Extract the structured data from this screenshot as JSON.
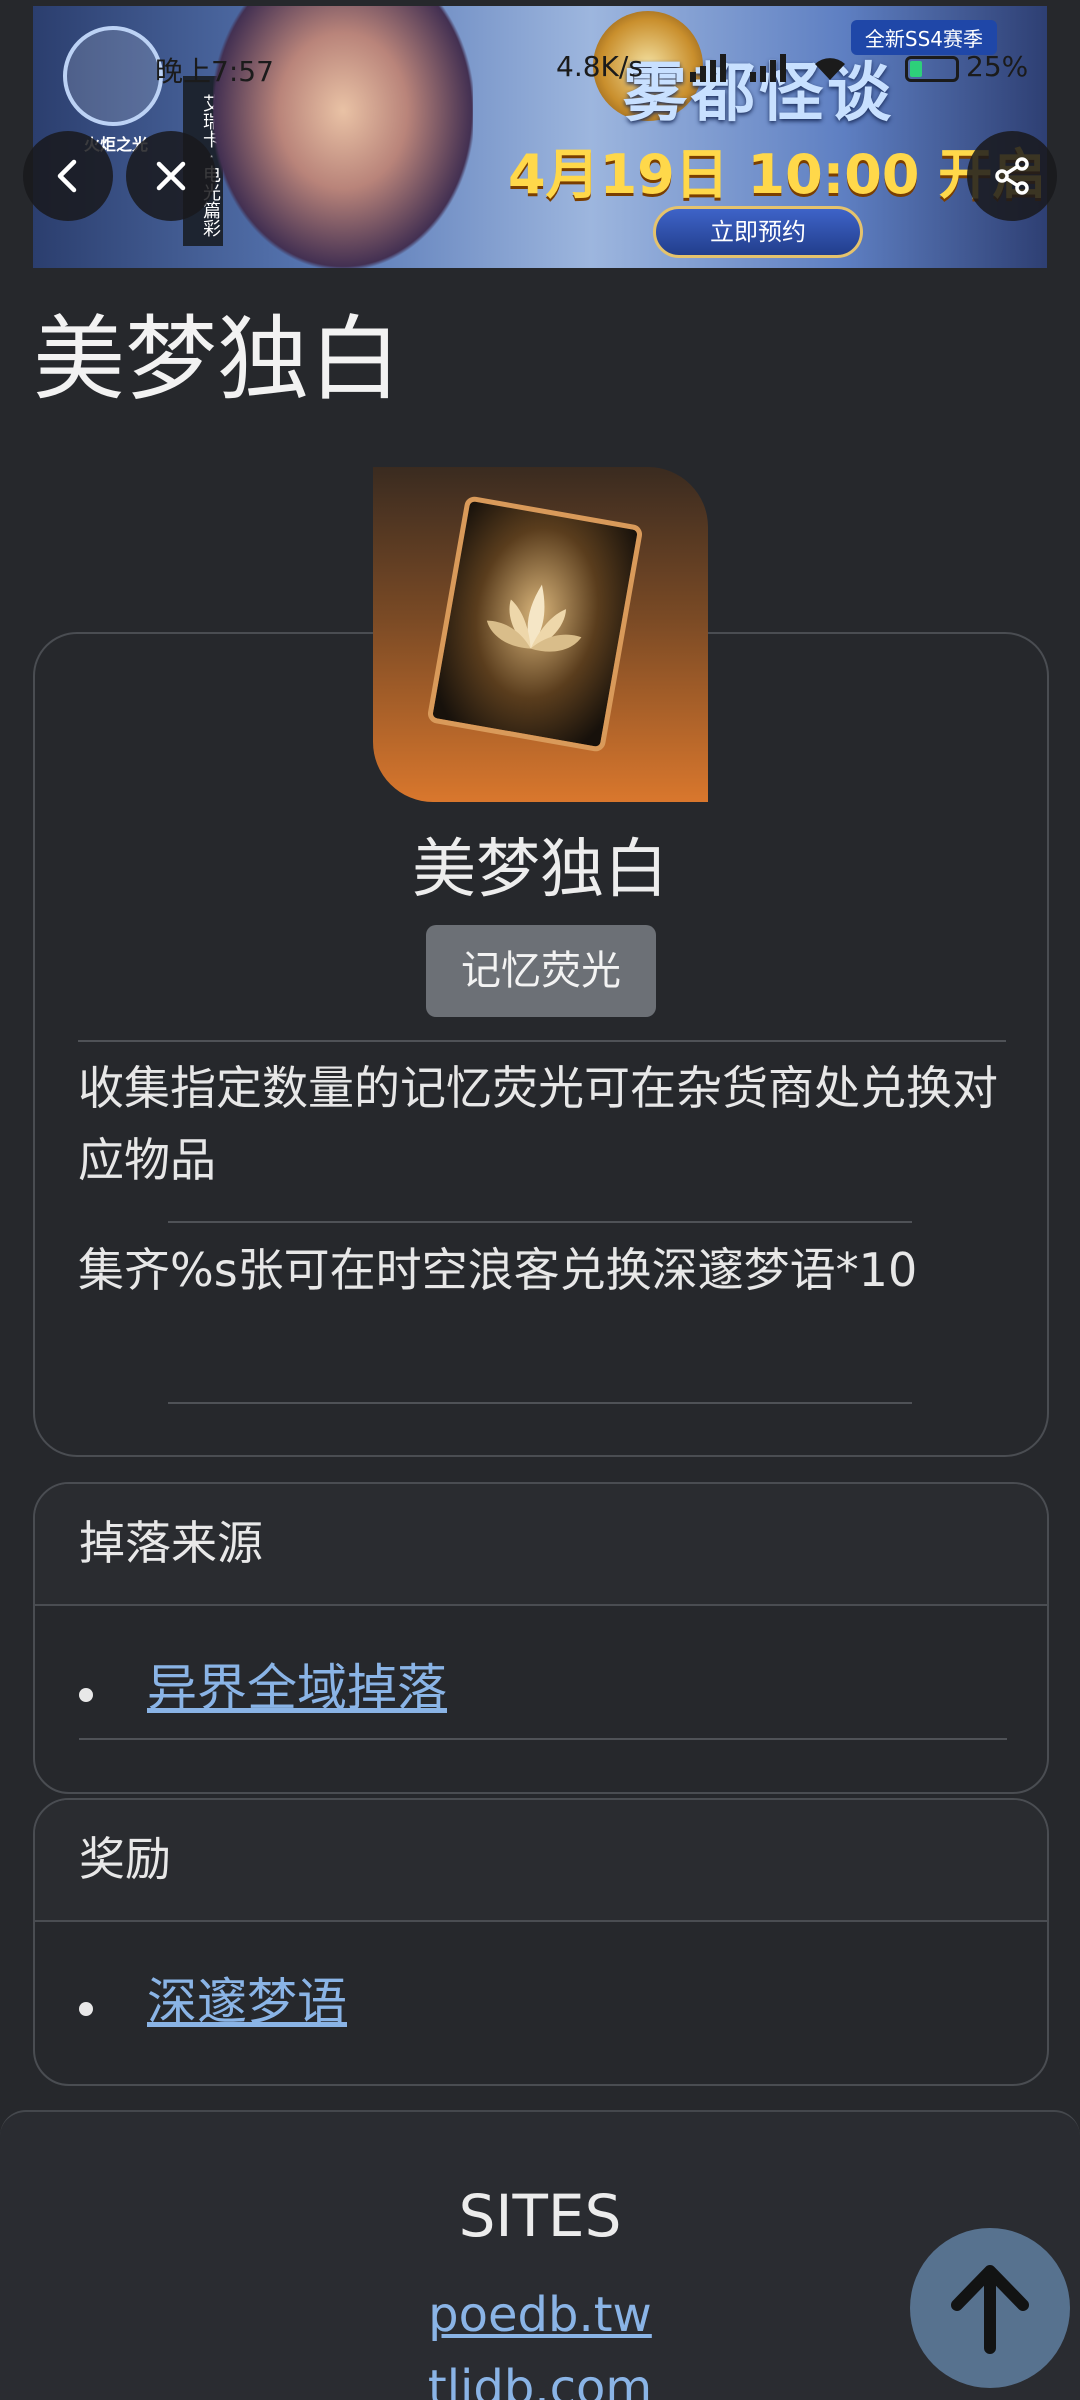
{
  "status_bar": {
    "time": "晚上7:57",
    "speed": "4.8K/s",
    "battery": "25"
  },
  "banner": {
    "logo_text": "火炬之光",
    "vertical_tag": "艾瑞卡 · 电光篇彩",
    "season": "全新SS4赛季",
    "title": "雾都怪谈",
    "date": "4月19日 10:00 开启",
    "reserve_label": "立即预约"
  },
  "nav": {
    "back_icon": "chevron-left-icon",
    "close_icon": "close-icon",
    "share_icon": "share-icon"
  },
  "page": {
    "title": "美梦独白"
  },
  "item": {
    "name": "美梦独白",
    "type_badge": "记忆荧光",
    "description_1": "收集指定数量的记忆荧光可在杂货商处兑换对应物品",
    "description_2": "集齐%s张可在时空浪客兑换深邃梦语*10"
  },
  "drop_source": {
    "heading": "掉落来源",
    "items": [
      "异界全域掉落"
    ]
  },
  "rewards": {
    "heading": "奖励",
    "items": [
      "深邃梦语"
    ]
  },
  "footer": {
    "heading": "SITES",
    "links": [
      "poedb.tw",
      "tlidb.com"
    ]
  }
}
